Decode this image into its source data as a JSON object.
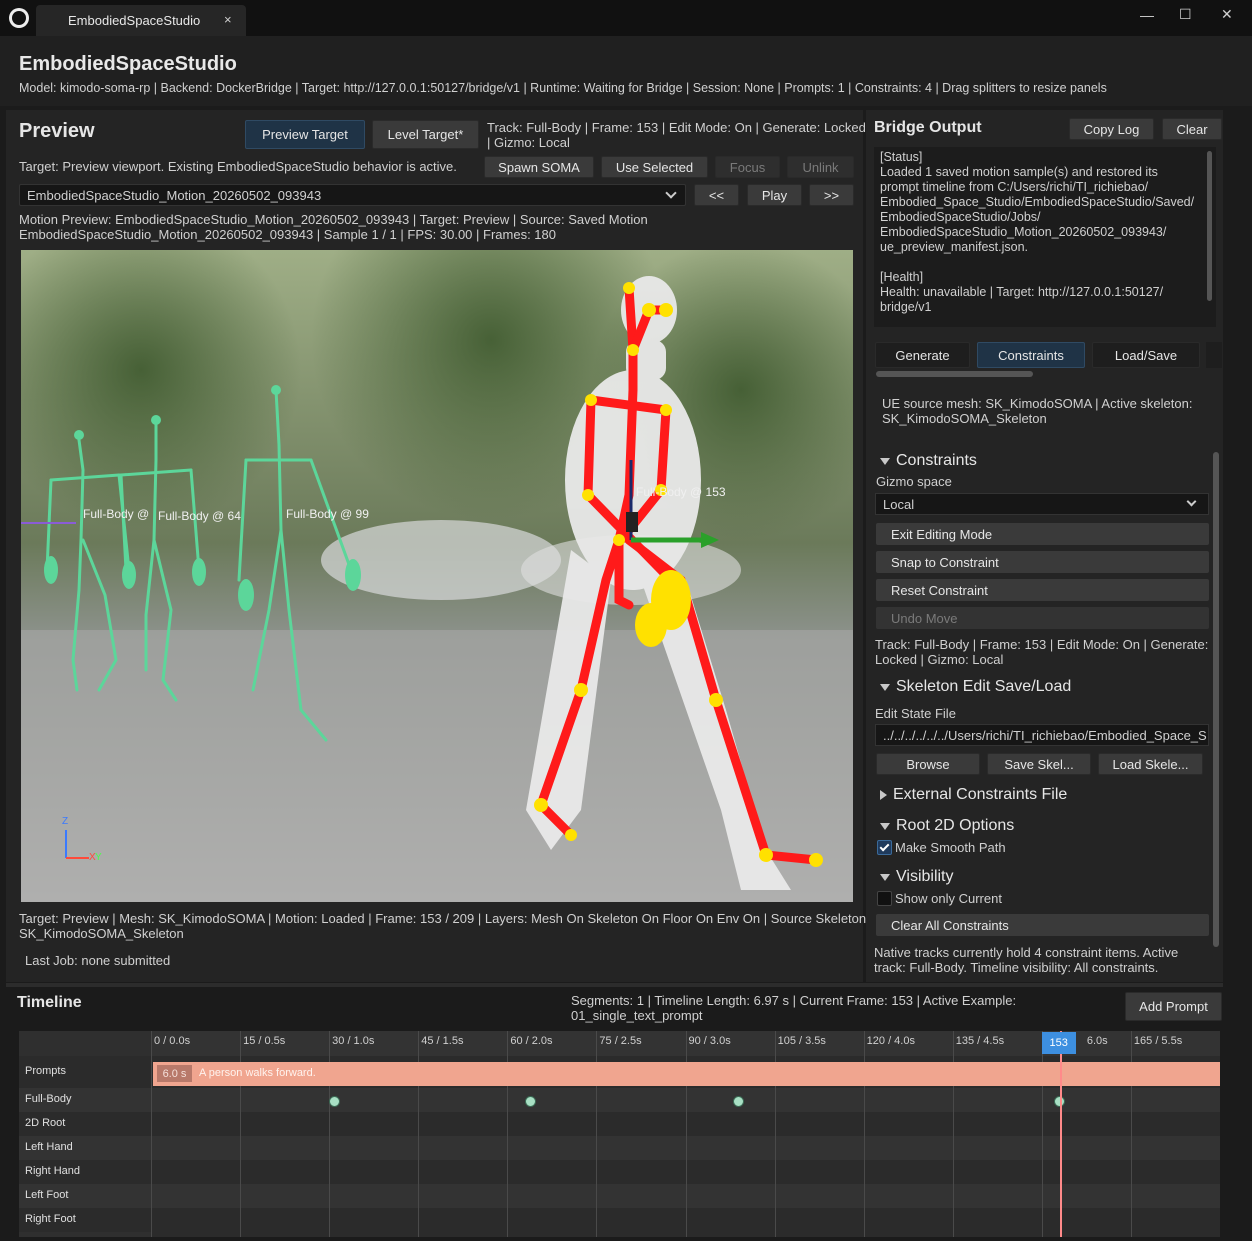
{
  "window": {
    "tab_title": "EmbodiedSpaceStudio",
    "tab_close": "×",
    "min": "—",
    "max": "☐",
    "close": "✕"
  },
  "header": {
    "title": "EmbodiedSpaceStudio",
    "info": "Model: kimodo-soma-rp | Backend: DockerBridge | Target: http://127.0.0.1:50127/bridge/v1 | Runtime: Waiting for Bridge | Session: None | Prompts: 1 | Constraints: 4 | Drag splitters to resize panels"
  },
  "preview": {
    "title": "Preview",
    "preview_target": "Preview Target",
    "level_target": "Level Target*",
    "status_line1": "Track: Full-Body | Frame: 153 | Edit Mode: On | Generate: Locked",
    "status_line2": "| Gizmo: Local",
    "target_note": "Target: Preview viewport. Existing EmbodiedSpaceStudio behavior is active.",
    "spawn": "Spawn SOMA",
    "use_selected": "Use Selected",
    "focus": "Focus",
    "unlink": "Unlink",
    "motion_select": "EmbodiedSpaceStudio_Motion_20260502_093943",
    "prev": "<<",
    "play": "Play",
    "next": ">>",
    "motion_info1": "Motion Preview: EmbodiedSpaceStudio_Motion_20260502_093943 | Target: Preview | Source: Saved Motion",
    "motion_info2": "EmbodiedSpaceStudio_Motion_20260502_093943 | Sample 1 / 1 | FPS: 30.00 | Frames: 180",
    "label_fb64": "Full-Body @ 64",
    "label_fb99": "Full-Body @ 99",
    "label_fb153": "Full-Body @ 153",
    "label_fbleft": "Full-Body @",
    "axis_z": "Z",
    "axis_x": "X",
    "axis_y": "Y",
    "footer1": "Target: Preview | Mesh: SK_KimodoSOMA | Motion: Loaded | Frame: 153 / 209 | Layers: Mesh On Skeleton On Floor On Env On | Source Skeleton:",
    "footer2": "SK_KimodoSOMA_Skeleton",
    "last_job": "Last Job: none submitted"
  },
  "bridge": {
    "title": "Bridge Output",
    "copy_log": "Copy Log",
    "clear": "Clear",
    "log": [
      "[Status]",
      "Loaded 1 saved motion sample(s) and restored its",
      "prompt timeline from C:/Users/richi/TI_richiebao/",
      "Embodied_Space_Studio/EmbodiedSpaceStudio/Saved/",
      "EmbodiedSpaceStudio/Jobs/",
      "EmbodiedSpaceStudio_Motion_20260502_093943/",
      "ue_preview_manifest.json.",
      "",
      "[Health]",
      "Health: unavailable | Target: http://127.0.0.1:50127/",
      "bridge/v1"
    ]
  },
  "tabs": {
    "generate": "Generate",
    "constraints": "Constraints",
    "load_save": "Load/Save"
  },
  "panel": {
    "mesh_info1": "UE source mesh: SK_KimodoSOMA | Active skeleton:",
    "mesh_info2": "SK_KimodoSOMA_Skeleton",
    "constraints_title": "Constraints",
    "gizmo_space": "Gizmo space",
    "gizmo_value": "Local",
    "exit_edit": "Exit Editing Mode",
    "snap": "Snap to Constraint",
    "reset": "Reset Constraint",
    "undo": "Undo Move",
    "track_info1": "Track: Full-Body | Frame: 153 | Edit Mode: On | Generate:",
    "track_info2": "Locked | Gizmo: Local",
    "skel_title": "Skeleton Edit Save/Load",
    "edit_state_file": "Edit State File",
    "file_path": "../../../../../../Users/richi/TI_richiebao/Embodied_Space_S",
    "browse": "Browse",
    "save_skel": "Save Skel...",
    "load_skel": "Load Skele...",
    "ext_title": "External Constraints File",
    "root_title": "Root 2D Options",
    "smooth": "Make Smooth Path",
    "vis_title": "Visibility",
    "show_current": "Show only Current",
    "clear_all": "Clear All Constraints",
    "native1": "Native tracks currently hold 4 constraint items. Active",
    "native2": "track: Full-Body. Timeline visibility: All constraints."
  },
  "timeline": {
    "title": "Timeline",
    "info1": "Segments: 1 | Timeline Length: 6.97 s | Current Frame: 153 | Active Example:",
    "info2": "01_single_text_prompt",
    "add_prompt": "Add Prompt",
    "ticks": [
      "0 / 0.0s",
      "15 / 0.5s",
      "30 / 1.0s",
      "45 / 1.5s",
      "60 / 2.0s",
      "75 / 2.5s",
      "90 / 3.0s",
      "105 / 3.5s",
      "120 / 4.0s",
      "135 / 4.5s",
      "6.0s",
      "165 / 5.5s"
    ],
    "current": "153",
    "rows": [
      "Prompts",
      "Full-Body",
      "2D Root",
      "Left Hand",
      "Right Hand",
      "Left Foot",
      "Right Foot"
    ],
    "prompt_dur": "6.0 s",
    "prompt_text": "A person walks forward.",
    "keyframes": [
      31,
      64,
      99,
      153
    ],
    "frames_total": 180
  }
}
